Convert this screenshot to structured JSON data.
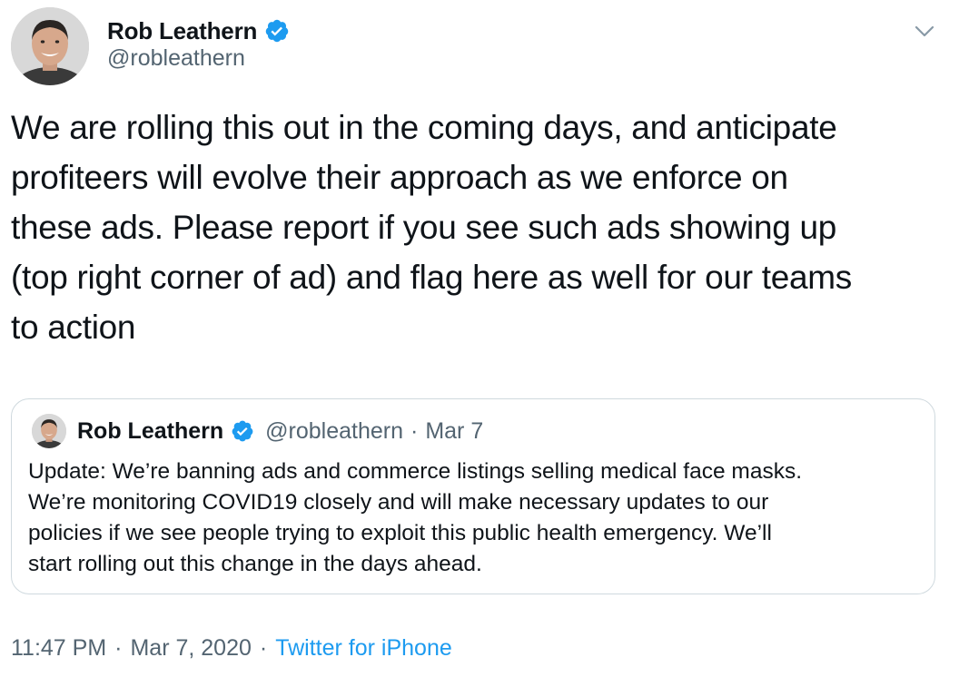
{
  "author": {
    "display_name": "Rob Leathern",
    "handle": "@robleathern",
    "verified": true
  },
  "tweet": {
    "text": "We are rolling this out in the coming days, and anticipate\nprofiteers will evolve their approach as we enforce on\nthese ads. Please report if you see such ads showing up\n(top right corner of ad) and flag here as well for our teams\nto action"
  },
  "quoted_tweet": {
    "display_name": "Rob Leathern",
    "handle": "@robleathern",
    "separator": "·",
    "date": "Mar 7",
    "text": "Update: We’re banning ads and commerce listings selling medical face masks.\nWe’re monitoring COVID19 closely and will make necessary updates to our\npolicies if we see people trying to exploit this public health emergency. We’ll\nstart rolling out this change in the days ahead."
  },
  "footer": {
    "time": "11:47 PM",
    "separator": "·",
    "date": "Mar 7, 2020",
    "source": "Twitter for iPhone"
  },
  "colors": {
    "primary_text": "#0f1419",
    "secondary_text": "#536471",
    "accent": "#1d9bf0",
    "border": "#cfd9de"
  },
  "icons": {
    "verified": "verified-badge-icon",
    "menu": "chevron-down-icon"
  }
}
